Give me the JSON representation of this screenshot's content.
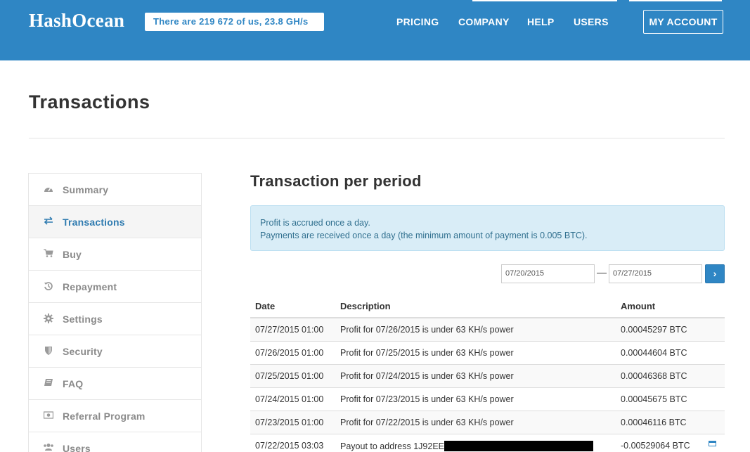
{
  "header": {
    "logo": "HashOcean",
    "stats": "There are 219 672 of us, 23.8 GH/s",
    "nav": [
      "PRICING",
      "COMPANY",
      "HELP",
      "USERS"
    ],
    "account_button": "MY ACCOUNT",
    "accent_color": "#2f86c4"
  },
  "page": {
    "title": "Transactions"
  },
  "sidebar": {
    "items": [
      {
        "label": "Summary",
        "icon": "dashboard-icon"
      },
      {
        "label": "Transactions",
        "icon": "exchange-icon",
        "active": true
      },
      {
        "label": "Buy",
        "icon": "cart-icon"
      },
      {
        "label": "Repayment",
        "icon": "history-icon"
      },
      {
        "label": "Settings",
        "icon": "gear-icon"
      },
      {
        "label": "Security",
        "icon": "shield-icon"
      },
      {
        "label": "FAQ",
        "icon": "book-icon"
      },
      {
        "label": "Referral Program",
        "icon": "money-icon"
      },
      {
        "label": "Users",
        "icon": "users-icon"
      }
    ]
  },
  "main": {
    "section_title": "Transaction per period",
    "info": {
      "line1": "Profit is accrued once a day.",
      "line2": "Payments are received once a day (the minimum amount of payment is 0.005 BTC)."
    },
    "date_from": "07/20/2015",
    "date_to": "07/27/2015",
    "date_separator": "—",
    "go_button": "›"
  },
  "table": {
    "headers": {
      "date": "Date",
      "description": "Description",
      "amount": "Amount"
    },
    "rows": [
      {
        "date": "07/27/2015 01:00",
        "description": "Profit for 07/26/2015 is under 63 KH/s power",
        "amount": "0.00045297 BTC"
      },
      {
        "date": "07/26/2015 01:00",
        "description": "Profit for 07/25/2015 is under 63 KH/s power",
        "amount": "0.00044604 BTC"
      },
      {
        "date": "07/25/2015 01:00",
        "description": "Profit for 07/24/2015 is under 63 KH/s power",
        "amount": "0.00046368 BTC"
      },
      {
        "date": "07/24/2015 01:00",
        "description": "Profit for 07/23/2015 is under 63 KH/s power",
        "amount": "0.00045675 BTC"
      },
      {
        "date": "07/23/2015 01:00",
        "description": "Profit for 07/22/2015 is under 63 KH/s power",
        "amount": "0.00046116 BTC"
      },
      {
        "date": "07/22/2015 03:03",
        "description": "Payout to address 1J92EE",
        "amount": "-0.00529064 BTC",
        "redacted": true
      }
    ]
  }
}
